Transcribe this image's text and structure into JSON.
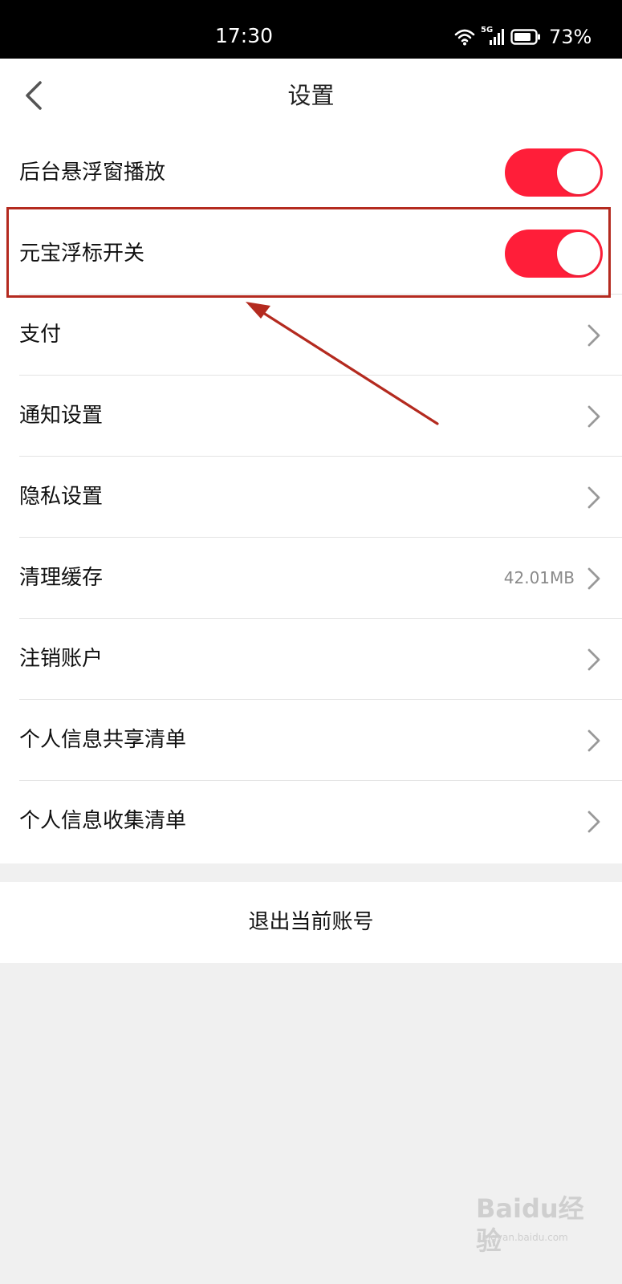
{
  "status_bar": {
    "time": "17:30",
    "network_badge": "5G",
    "battery_percent": "73%",
    "icons": [
      "wifi-icon",
      "signal-icon",
      "battery-icon"
    ]
  },
  "header": {
    "title": "设置",
    "back_icon": "chevron-left-icon"
  },
  "settings": {
    "rows": [
      {
        "label": "后台悬浮窗播放",
        "control": "toggle",
        "on": true
      },
      {
        "label": "元宝浮标开关",
        "control": "toggle",
        "on": true
      },
      {
        "label": "支付",
        "control": "chevron"
      },
      {
        "label": "通知设置",
        "control": "chevron"
      },
      {
        "label": "隐私设置",
        "control": "chevron"
      },
      {
        "label": "清理缓存",
        "control": "chevron",
        "value": "42.01MB"
      },
      {
        "label": "注销账户",
        "control": "chevron"
      },
      {
        "label": "个人信息共享清单",
        "control": "chevron"
      },
      {
        "label": "个人信息收集清单",
        "control": "chevron"
      }
    ]
  },
  "logout_label": "退出当前账号",
  "watermark": {
    "brand": "Baidu经验",
    "site": "jingyan.baidu.com"
  },
  "colors": {
    "toggle_on": "#ff1e39",
    "annotation": "#b42a1f",
    "background": "#f0f0f0"
  }
}
